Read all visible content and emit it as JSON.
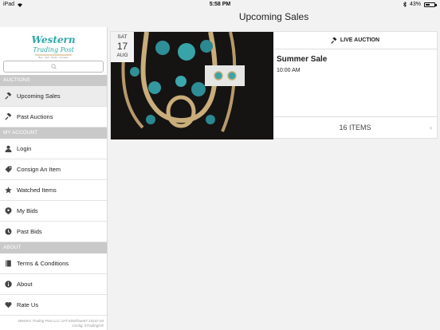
{
  "status": {
    "device": "iPad",
    "time": "5:58 PM",
    "battery": "43%"
  },
  "nav": {
    "title": "Upcoming Sales"
  },
  "sidebar": {
    "logo_text": "Western Trading Post",
    "search": {
      "placeholder": ""
    },
    "sections": [
      {
        "label": "AUCTIONS",
        "items": [
          {
            "label": "Upcoming Sales",
            "icon": "gavel-icon"
          },
          {
            "label": "Past Auctions",
            "icon": "gavel-icon"
          }
        ]
      },
      {
        "label": "MY ACCOUNT",
        "items": [
          {
            "label": "Login",
            "icon": "user-icon"
          },
          {
            "label": "Consign An Item",
            "icon": "tag-icon"
          },
          {
            "label": "Watched Items",
            "icon": "star-icon"
          },
          {
            "label": "My Bids",
            "icon": "bid-icon"
          },
          {
            "label": "Past Bids",
            "icon": "history-icon"
          }
        ]
      },
      {
        "label": "ABOUT",
        "items": [
          {
            "label": "Terms & Conditions",
            "icon": "book-icon"
          },
          {
            "label": "About",
            "icon": "info-icon"
          },
          {
            "label": "Rate Us",
            "icon": "heart-icon"
          }
        ]
      }
    ],
    "footer_line1": "Western Trading Post LLC UAT:6592f5ae67:15247-04",
    "footer_line2": "Config: 5TradingGR"
  },
  "sale": {
    "dow": "SAT",
    "day": "17",
    "month": "AUG",
    "badge": "LIVE AUCTION",
    "title": "Summer Sale",
    "time": "10:00 AM",
    "items": "16 ITEMS"
  }
}
